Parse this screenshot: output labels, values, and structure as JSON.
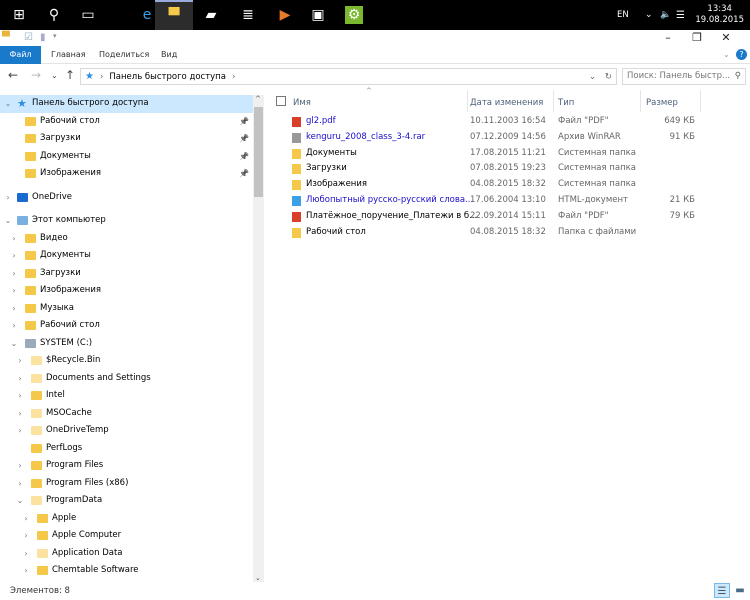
{
  "taskbar": {
    "apps": [
      {
        "icon": "start-icon",
        "glyph": "⊞"
      },
      {
        "icon": "search-icon",
        "glyph": "⚲"
      },
      {
        "icon": "task-view-icon",
        "glyph": "▭"
      },
      {
        "icon": "edge-icon",
        "glyph": "e"
      },
      {
        "icon": "file-explorer-icon",
        "glyph": "▀"
      },
      {
        "icon": "notepad-icon",
        "glyph": "▰"
      },
      {
        "icon": "database-icon",
        "glyph": "≣"
      },
      {
        "icon": "media-player-icon",
        "glyph": "▶"
      },
      {
        "icon": "store-icon",
        "glyph": "▣"
      },
      {
        "icon": "settings-icon",
        "glyph": "⚙"
      }
    ],
    "lang": "EN",
    "time": "13:34",
    "date": "19.08.2015"
  },
  "ribbon": {
    "tabs": [
      "Файл",
      "Главная",
      "Поделиться",
      "Вид"
    ]
  },
  "address": {
    "path": "Панель быстрого доступа",
    "search_placeholder": "Поиск: Панель быстр..."
  },
  "tree": [
    {
      "label": "Панель быстрого доступа",
      "level": 0,
      "arrow": "open",
      "icon": "star",
      "selected": true
    },
    {
      "label": "Рабочий стол",
      "level": 1,
      "arrow": "",
      "icon": "desktop",
      "pinned": true
    },
    {
      "label": "Загрузки",
      "level": 1,
      "arrow": "",
      "icon": "downloads",
      "pinned": true
    },
    {
      "label": "Документы",
      "level": 1,
      "arrow": "",
      "icon": "documents",
      "pinned": true
    },
    {
      "label": "Изображения",
      "level": 1,
      "arrow": "",
      "icon": "pictures",
      "pinned": true,
      "gapAfter": true
    },
    {
      "label": "OneDrive",
      "level": 0,
      "arrow": "closed",
      "icon": "onedrive",
      "gapAfter": true
    },
    {
      "label": "Этот компьютер",
      "level": 0,
      "arrow": "open",
      "icon": "computer"
    },
    {
      "label": "Видео",
      "level": 1,
      "arrow": "closed",
      "icon": "video"
    },
    {
      "label": "Документы",
      "level": 1,
      "arrow": "closed",
      "icon": "documents"
    },
    {
      "label": "Загрузки",
      "level": 1,
      "arrow": "closed",
      "icon": "downloads"
    },
    {
      "label": "Изображения",
      "level": 1,
      "arrow": "closed",
      "icon": "pictures"
    },
    {
      "label": "Музыка",
      "level": 1,
      "arrow": "closed",
      "icon": "music"
    },
    {
      "label": "Рабочий стол",
      "level": 1,
      "arrow": "closed",
      "icon": "desktop"
    },
    {
      "label": "SYSTEM (C:)",
      "level": 1,
      "arrow": "open",
      "icon": "drive"
    },
    {
      "label": "$Recycle.Bin",
      "level": 2,
      "arrow": "closed",
      "icon": "folder-faded"
    },
    {
      "label": "Documents and Settings",
      "level": 2,
      "arrow": "closed",
      "icon": "shortcut"
    },
    {
      "label": "Intel",
      "level": 2,
      "arrow": "closed",
      "icon": "folder"
    },
    {
      "label": "MSOCache",
      "level": 2,
      "arrow": "closed",
      "icon": "folder-faded"
    },
    {
      "label": "OneDriveTemp",
      "level": 2,
      "arrow": "closed",
      "icon": "folder-faded"
    },
    {
      "label": "PerfLogs",
      "level": 2,
      "arrow": "",
      "icon": "folder"
    },
    {
      "label": "Program Files",
      "level": 2,
      "arrow": "closed",
      "icon": "folder"
    },
    {
      "label": "Program Files (x86)",
      "level": 2,
      "arrow": "closed",
      "icon": "folder"
    },
    {
      "label": "ProgramData",
      "level": 2,
      "arrow": "open",
      "icon": "folder-faded"
    },
    {
      "label": "Apple",
      "level": 3,
      "arrow": "closed",
      "icon": "folder"
    },
    {
      "label": "Apple Computer",
      "level": 3,
      "arrow": "closed",
      "icon": "folder"
    },
    {
      "label": "Application Data",
      "level": 3,
      "arrow": "closed",
      "icon": "shortcut"
    },
    {
      "label": "Chemtable Software",
      "level": 3,
      "arrow": "closed",
      "icon": "folder"
    }
  ],
  "columns": [
    "Имя",
    "Дата изменения",
    "Тип",
    "Размер"
  ],
  "files": [
    {
      "name": "gl2.pdf",
      "date": "10.11.2003 16:54",
      "type": "Файл \"PDF\"",
      "size": "649 КБ",
      "icon": "pdf",
      "link": true
    },
    {
      "name": "kenguru_2008_class_3-4.rar",
      "date": "07.12.2009 14:56",
      "type": "Архив WinRAR",
      "size": "91 КБ",
      "icon": "rar",
      "link": true
    },
    {
      "name": "Документы",
      "date": "17.08.2015 11:21",
      "type": "Системная папка",
      "size": "",
      "icon": "documents"
    },
    {
      "name": "Загрузки",
      "date": "07.08.2015 19:23",
      "type": "Системная папка",
      "size": "",
      "icon": "downloads"
    },
    {
      "name": "Изображения",
      "date": "04.08.2015 18:32",
      "type": "Системная папка",
      "size": "",
      "icon": "pictures"
    },
    {
      "name": "Любопытный русско-русский слова...",
      "date": "17.06.2004 13:10",
      "type": "HTML-документ",
      "size": "21 КБ",
      "icon": "html",
      "link": true
    },
    {
      "name": "Платёжное_поручение_Платежи в б...",
      "date": "22.09.2014 15:11",
      "type": "Файл \"PDF\"",
      "size": "79 КБ",
      "icon": "pdf"
    },
    {
      "name": "Рабочий стол",
      "date": "04.08.2015 18:32",
      "type": "Папка с файлами",
      "size": "",
      "icon": "desktop"
    }
  ],
  "status": {
    "items": "Элементов: 8"
  },
  "colors": {
    "accent": "#1979ca",
    "selection": "#cce8ff",
    "link": "#1a0dcd",
    "folder": "#f5c84a"
  }
}
